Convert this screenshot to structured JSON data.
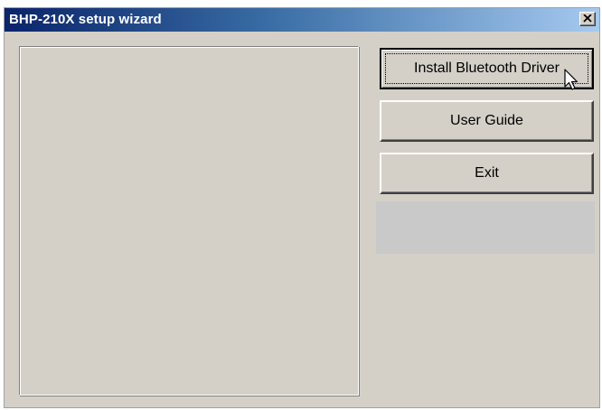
{
  "window": {
    "title": "BHP-210X setup wizard",
    "close_icon": "close-icon"
  },
  "buttons": {
    "install_label": "Install Bluetooth Driver",
    "guide_label": "User Guide",
    "exit_label": "Exit"
  },
  "cursor": {
    "icon": "mouse-pointer-icon"
  },
  "colors": {
    "titlebar_start": "#0a246a",
    "titlebar_end": "#a6caf0",
    "window_bg": "#d4d0c8"
  }
}
